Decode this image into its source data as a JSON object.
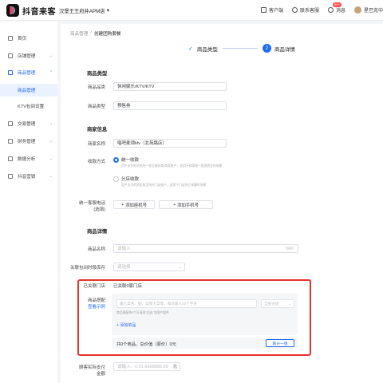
{
  "topbar": {
    "logo_text": "抖音来客",
    "shop_name": "汉堡王王府井APM店",
    "shop_caret": "▾",
    "items": [
      {
        "label": "客户端",
        "icon": "monitor-icon"
      },
      {
        "label": "联系客服",
        "icon": "headset-icon"
      },
      {
        "label": "消息",
        "icon": "bell-icon",
        "badge": "99+"
      },
      {
        "label": "星巴克中",
        "icon": "avatar"
      }
    ]
  },
  "sidebar": {
    "items": [
      {
        "label": "首页",
        "icon": "home-icon",
        "chevron": ""
      },
      {
        "label": "店铺管理",
        "icon": "store-icon",
        "chevron": "⌄"
      },
      {
        "label": "商品管理",
        "icon": "goods-icon",
        "chevron": "⌃"
      },
      {
        "label": "商品管理",
        "icon": "",
        "chevron": ""
      },
      {
        "label": "KTV包间设置",
        "icon": "",
        "chevron": ""
      },
      {
        "label": "交易管理",
        "icon": "trade-icon",
        "chevron": "⌄"
      },
      {
        "label": "财务管理",
        "icon": "finance-icon",
        "chevron": "⌄"
      },
      {
        "label": "数据分析",
        "icon": "chart-icon",
        "chevron": "⌄"
      },
      {
        "label": "抖音营销",
        "icon": "marketing-icon",
        "chevron": "⌄"
      }
    ]
  },
  "breadcrumb": {
    "parent": "商品管理",
    "sep": "/",
    "current": "创建团购套餐"
  },
  "steps": {
    "step1": "商品类型",
    "step1_check": "✓",
    "step2_num": "2",
    "step2": "商品详情"
  },
  "product_type": {
    "title": "商品类型",
    "category_label": "商品品类",
    "category_value": "休闲娱乐/KTV/KTV",
    "type_label": "商品类型",
    "type_value": "预售券"
  },
  "merchant": {
    "title": "商家信息",
    "name_label": "商家名称",
    "name_value": "唱吧麦颂ktv（北苑路店）",
    "pay_label": "收款方式",
    "pay_option1": "统一收款",
    "pay_hint1": "用户支付的资金统一收至服务商/商家账户，适用于商家统一管理资金的场景",
    "pay_option2": "分店收款",
    "pay_hint2": "用户支付的资金收至所在门店账户，适用于门店独立核算的场景",
    "phone_label_1": "统一客服电话",
    "phone_label_2": "(选填)",
    "add_landline": "添加座机号",
    "add_mobile": "添加手机号",
    "plus": "+"
  },
  "detail": {
    "title": "商品详情",
    "name_label": "商品名称",
    "name_placeholder": "请输入",
    "name_counter": "0/40",
    "room_label": "关联包间时段库存",
    "room_placeholder": "请选择",
    "room_arrow": "⌄",
    "store_label": "已关联门店",
    "store_value": "已关联0家门店",
    "combo_label": "商品搭配",
    "combo_example": "查看示例",
    "search_placeholder": "输入菜名、剧、菜量大菜等，每次输入10个字符",
    "filter_placeholder": "全部分组",
    "filter_arrow": "⌄",
    "combo_hint": "商品搭配共0个可选项\"全选\"为团户组件",
    "add_goods": "添加单品",
    "summary": "共0个商品，总价值（原价）0元",
    "add_group": "再分一组",
    "pay_label_1": "顾客实际支付",
    "pay_label_2": "金额",
    "pay_placeholder": "请输入，0.01-9999999.99",
    "pay_unit": "元"
  }
}
